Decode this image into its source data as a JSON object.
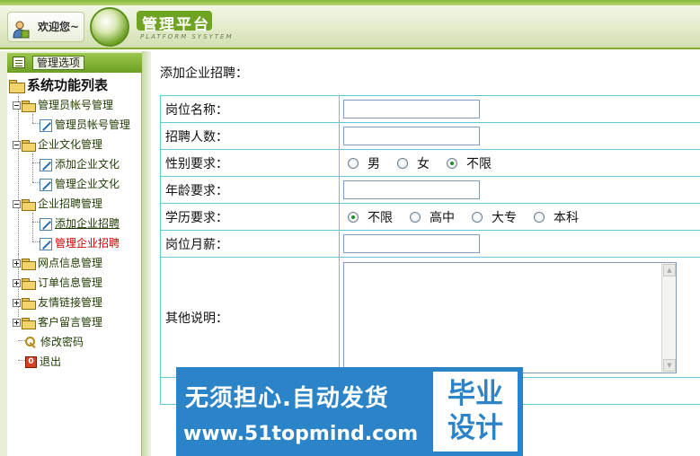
{
  "header": {
    "welcome": "欢迎您~",
    "logo_title": "管理平台",
    "logo_subtitle": "PLATFORM SYSYTEM"
  },
  "sidebar": {
    "head_button": "管理选项",
    "tree_title": "系统功能列表",
    "items": [
      {
        "label": "管理员帐号管理",
        "type": "group",
        "expanded": true
      },
      {
        "label": "管理员帐号管理",
        "type": "child"
      },
      {
        "label": "企业文化管理",
        "type": "group",
        "expanded": true
      },
      {
        "label": "添加企业文化",
        "type": "child"
      },
      {
        "label": "管理企业文化",
        "type": "child"
      },
      {
        "label": "企业招聘管理",
        "type": "group",
        "expanded": true
      },
      {
        "label": "添加企业招聘",
        "type": "child",
        "hover": true
      },
      {
        "label": "管理企业招聘",
        "type": "child",
        "active": true
      },
      {
        "label": "网点信息管理",
        "type": "group",
        "expanded": false
      },
      {
        "label": "订单信息管理",
        "type": "group",
        "expanded": false
      },
      {
        "label": "友情链接管理",
        "type": "group",
        "expanded": false
      },
      {
        "label": "客户留言管理",
        "type": "group",
        "expanded": false
      },
      {
        "label": "修改密码",
        "type": "action",
        "icon": "key-icon"
      },
      {
        "label": "退出",
        "type": "action",
        "icon": "exit-icon"
      }
    ]
  },
  "main": {
    "title": "添加企业招聘：",
    "fields": {
      "position": {
        "label": "岗位名称：",
        "value": ""
      },
      "headcount": {
        "label": "招聘人数：",
        "value": ""
      },
      "gender": {
        "label": "性别要求：",
        "options": [
          "男",
          "女",
          "不限"
        ],
        "selected": "不限"
      },
      "age": {
        "label": "年龄要求：",
        "value": ""
      },
      "education": {
        "label": "学历要求：",
        "options": [
          "不限",
          "高中",
          "大专",
          "本科"
        ],
        "selected": "不限"
      },
      "salary": {
        "label": "岗位月薪：",
        "value": ""
      },
      "notes": {
        "label": "其他说明：",
        "value": ""
      }
    }
  },
  "watermark": {
    "line1": "无须担心.自动发货",
    "line2": "www.51topmind.com",
    "badge": "毕业设计"
  },
  "colors": {
    "brand_green": "#6fa322",
    "table_border": "#5fc9d8",
    "active_link": "#cc0000",
    "watermark_blue": "#2c84c8"
  }
}
